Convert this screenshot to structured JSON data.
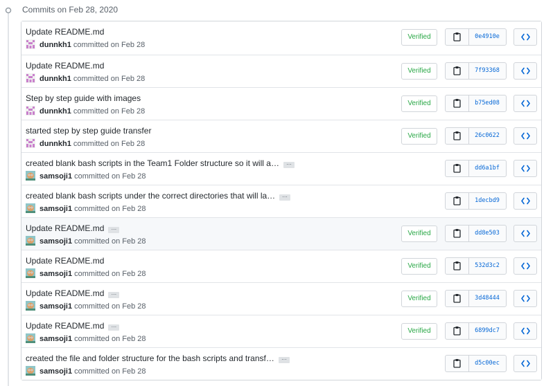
{
  "group": {
    "title": "Commits on Feb 28, 2020"
  },
  "commits": [
    {
      "title": "Update README.md",
      "has_ellipsis": false,
      "author": "dunnkh1",
      "committed": "committed on Feb 28",
      "verified": true,
      "sha": "0e4910e",
      "avatar": "identicon",
      "highlight": false
    },
    {
      "title": "Update README.md",
      "has_ellipsis": false,
      "author": "dunnkh1",
      "committed": "committed on Feb 28",
      "verified": true,
      "sha": "7f93368",
      "avatar": "identicon",
      "highlight": false
    },
    {
      "title": "Step by step guide with images",
      "has_ellipsis": false,
      "author": "dunnkh1",
      "committed": "committed on Feb 28",
      "verified": true,
      "sha": "b75ed08",
      "avatar": "identicon",
      "highlight": false
    },
    {
      "title": "started step by step guide transfer",
      "has_ellipsis": false,
      "author": "dunnkh1",
      "committed": "committed on Feb 28",
      "verified": true,
      "sha": "26c0622",
      "avatar": "identicon",
      "highlight": false
    },
    {
      "title": "created blank bash scripts in the Team1 Folder structure so it will a…",
      "has_ellipsis": true,
      "author": "samsoji1",
      "committed": "committed on Feb 28",
      "verified": false,
      "sha": "dd6a1bf",
      "avatar": "photo",
      "highlight": false
    },
    {
      "title": "created blank bash scripts under the correct directories that will la…",
      "has_ellipsis": true,
      "author": "samsoji1",
      "committed": "committed on Feb 28",
      "verified": false,
      "sha": "1decbd9",
      "avatar": "photo",
      "highlight": false
    },
    {
      "title": "Update README.md",
      "has_ellipsis": true,
      "author": "samsoji1",
      "committed": "committed on Feb 28",
      "verified": true,
      "sha": "dd8e503",
      "avatar": "photo",
      "highlight": true
    },
    {
      "title": "Update README.md",
      "has_ellipsis": false,
      "author": "samsoji1",
      "committed": "committed on Feb 28",
      "verified": true,
      "sha": "532d3c2",
      "avatar": "photo",
      "highlight": false
    },
    {
      "title": "Update README.md",
      "has_ellipsis": true,
      "author": "samsoji1",
      "committed": "committed on Feb 28",
      "verified": true,
      "sha": "3d48444",
      "avatar": "photo",
      "highlight": false
    },
    {
      "title": "Update README.md",
      "has_ellipsis": true,
      "author": "samsoji1",
      "committed": "committed on Feb 28",
      "verified": true,
      "sha": "6899dc7",
      "avatar": "photo",
      "highlight": false
    },
    {
      "title": "created the file and folder structure for the bash scripts and transf…",
      "has_ellipsis": true,
      "author": "samsoji1",
      "committed": "committed on Feb 28",
      "verified": false,
      "sha": "d5c00ec",
      "avatar": "photo",
      "highlight": false
    }
  ],
  "labels": {
    "verified": "Verified",
    "ellipsis": "…"
  },
  "icons": {
    "timeline": "git-commit-icon",
    "copy": "clippy-icon",
    "browse": "code-icon"
  },
  "colors": {
    "verified_green": "#28a745",
    "sha_blue": "#0366d6",
    "highlight_row": "#f6f8fa"
  }
}
